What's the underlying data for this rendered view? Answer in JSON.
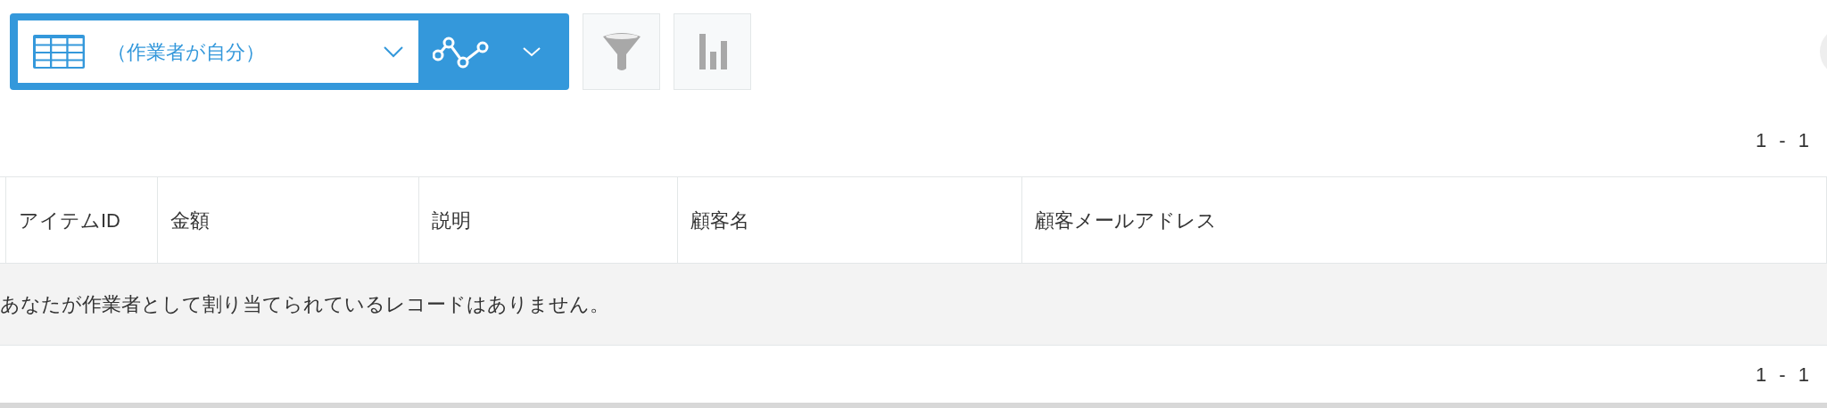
{
  "toolbar": {
    "view_select": {
      "value": "（作業者が自分）"
    }
  },
  "pagination_top": "1 - 1",
  "table": {
    "columns": [
      "アイテムID",
      "金額",
      "説明",
      "顧客名",
      "顧客メールアドレス"
    ],
    "empty_message": "あなたが作業者として割り当てられているレコードはありません。"
  },
  "pagination_bottom": "1 - 1"
}
